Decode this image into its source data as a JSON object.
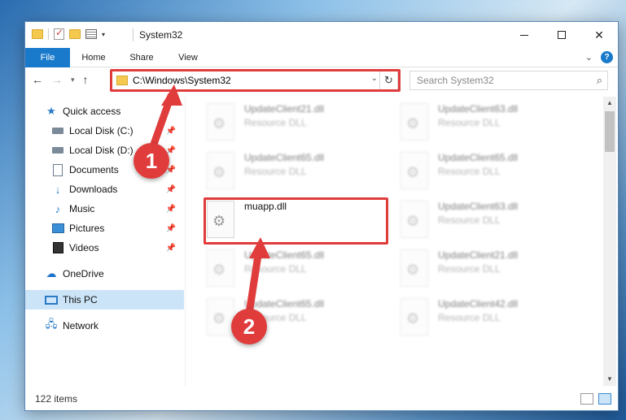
{
  "window": {
    "title": "System32"
  },
  "ribbon": {
    "tabs": [
      {
        "label": "File"
      },
      {
        "label": "Home"
      },
      {
        "label": "Share"
      },
      {
        "label": "View"
      }
    ]
  },
  "address": {
    "path": "C:\\Windows\\System32"
  },
  "search": {
    "placeholder": "Search System32"
  },
  "sidebar": {
    "items": [
      {
        "label": "Quick access",
        "icon": "star-icon"
      },
      {
        "label": "Local Disk (C:)",
        "icon": "disk-icon",
        "pinned": true
      },
      {
        "label": "Local Disk (D:)",
        "icon": "disk-icon",
        "pinned": true
      },
      {
        "label": "Documents",
        "icon": "documents-icon",
        "pinned": true
      },
      {
        "label": "Downloads",
        "icon": "download-icon",
        "pinned": true
      },
      {
        "label": "Music",
        "icon": "music-icon",
        "pinned": true
      },
      {
        "label": "Pictures",
        "icon": "pictures-icon",
        "pinned": true
      },
      {
        "label": "Videos",
        "icon": "videos-icon",
        "pinned": true
      },
      {
        "label": "OneDrive",
        "icon": "cloud-icon"
      },
      {
        "label": "This PC",
        "icon": "pc-icon",
        "selected": true
      },
      {
        "label": "Network",
        "icon": "network-icon"
      }
    ]
  },
  "files": [
    {
      "name": "UpdateClient21.dll",
      "type": "Resource DLL"
    },
    {
      "name": "UpdateClient63.dll",
      "type": "Resource DLL"
    },
    {
      "name": "UpdateClient65.dll",
      "type": "Resource DLL"
    },
    {
      "name": "UpdateClient65.dll",
      "type": "Resource DLL"
    },
    {
      "name": "muapp.dll",
      "type": ""
    },
    {
      "name": "UpdateClient63.dll",
      "type": "Resource DLL"
    },
    {
      "name": "UpdateClient65.dll",
      "type": "Resource DLL"
    },
    {
      "name": "UpdateClient21.dll",
      "type": "Resource DLL"
    },
    {
      "name": "UpdateClient65.dll",
      "type": "Resource DLL"
    },
    {
      "name": "UpdateClient42.dll",
      "type": "Resource DLL"
    }
  ],
  "status": {
    "item_count": "122 items"
  },
  "callouts": [
    {
      "number": "1"
    },
    {
      "number": "2"
    }
  ],
  "colors": {
    "accent": "#1979ca",
    "callout": "#e03c3c",
    "selection": "#cce4f7"
  }
}
